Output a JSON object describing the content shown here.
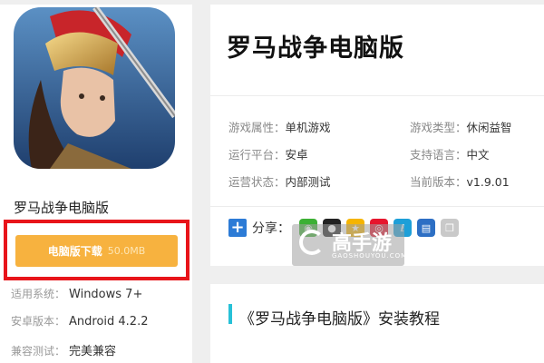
{
  "app": {
    "name": "罗马战争电脑版",
    "download_label": "电脑版下载",
    "download_size": "50.0MB"
  },
  "left_meta": [
    {
      "label": "适用系统：",
      "value": "Windows 7+"
    },
    {
      "label": "安卓版本：",
      "value": "Android 4.2.2"
    },
    {
      "label": "兼容测试：",
      "value": "完美兼容"
    }
  ],
  "detail": {
    "title": "罗马战争电脑版",
    "attributes": [
      {
        "label": "游戏属性：",
        "value": "单机游戏"
      },
      {
        "label": "游戏类型：",
        "value": "休闲益智"
      },
      {
        "label": "运行平台：",
        "value": "安卓"
      },
      {
        "label": "支持语言：",
        "value": "中文"
      },
      {
        "label": "运营状态：",
        "value": "内部测试"
      },
      {
        "label": "当前版本：",
        "value": "v1.9.01"
      }
    ],
    "share_label": "分享："
  },
  "share_icons": [
    {
      "name": "wechat-icon",
      "color": "#3cb034"
    },
    {
      "name": "qq-icon",
      "color": "#1b1b1b"
    },
    {
      "name": "qzone-icon",
      "color": "#f5b400"
    },
    {
      "name": "weibo-icon",
      "color": "#e6162d"
    },
    {
      "name": "tencent-weibo-icon",
      "color": "#1d9fd8"
    },
    {
      "name": "print-icon",
      "color": "#2d6fc4"
    },
    {
      "name": "copy-icon",
      "color": "#b5b5b5"
    }
  ],
  "watermark": {
    "text": "高手游",
    "sub": "GAOSHOUYOU.COM"
  },
  "section": {
    "title": "《罗马战争电脑版》安装教程"
  },
  "colors": {
    "accent": "#f7b23f",
    "highlight_border": "#e8141a",
    "section_bar": "#27c1d7"
  }
}
